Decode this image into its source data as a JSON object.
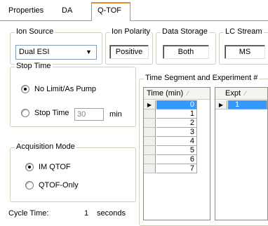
{
  "tabs": [
    {
      "label": "Properties"
    },
    {
      "label": "DA"
    },
    {
      "label": "Q-TOF"
    }
  ],
  "ion_source": {
    "title": "Ion Source",
    "value": "Dual ESI"
  },
  "ion_polarity": {
    "title": "Ion Polarity",
    "value": "Positive"
  },
  "data_storage": {
    "title": "Data Storage",
    "value": "Both"
  },
  "lc_stream": {
    "title": "LC Stream",
    "value": "MS"
  },
  "stop_time": {
    "title": "Stop Time",
    "option_no_limit": "No Limit/As Pump",
    "option_stop_time": "Stop Time",
    "stop_time_value": "30",
    "unit": "min"
  },
  "acquisition_mode": {
    "title": "Acquisition Mode",
    "option_im": "IM QTOF",
    "option_qtof": "QTOF-Only"
  },
  "time_segment": {
    "title": "Time Segment and Experiment #",
    "time_header": "Time (min)",
    "time_rows": [
      "0",
      "1",
      "2",
      "3",
      "4",
      "5",
      "6",
      "7"
    ],
    "expt_header": "Expt",
    "expt_rows": [
      "1"
    ]
  },
  "cycle_time": {
    "label": "Cycle Time:",
    "value": "1",
    "unit": "seconds"
  },
  "icons": {
    "dropdown": "chevron-down-icon",
    "sort": "sort-icon",
    "row_pointer": "row-pointer-icon"
  },
  "colors": {
    "selected_row": "#3399ff",
    "active_tab": "#e68b2c"
  }
}
